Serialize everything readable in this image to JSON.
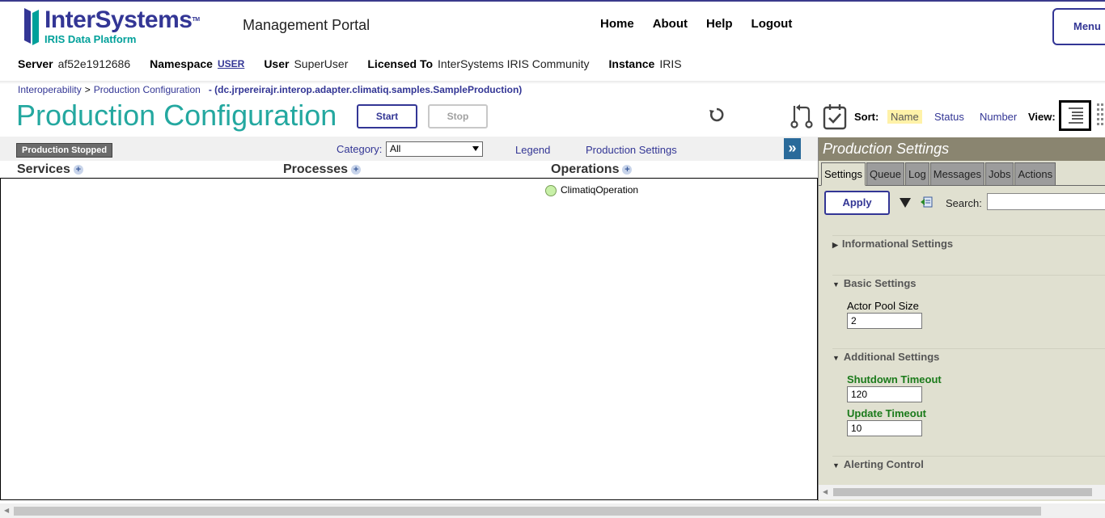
{
  "header": {
    "logo_name": "InterSystems",
    "logo_sub": "IRIS Data Platform",
    "portal_title": "Management Portal",
    "nav": [
      "Home",
      "About",
      "Help",
      "Logout"
    ],
    "menu_label": "Menu"
  },
  "info": {
    "server_label": "Server",
    "server": "af52e1912686",
    "namespace_label": "Namespace",
    "namespace": "USER",
    "user_label": "User",
    "user": "SuperUser",
    "licensed_label": "Licensed To",
    "licensed": "InterSystems IRIS Community",
    "instance_label": "Instance",
    "instance": "IRIS"
  },
  "breadcrumb": {
    "root": "Interoperability",
    "sep": ">",
    "current": "Production Configuration",
    "production": "- (dc.jrpereirajr.interop.adapter.climatiq.samples.SampleProduction)"
  },
  "page": {
    "title": "Production Configuration",
    "start_label": "Start",
    "stop_label": "Stop"
  },
  "sort": {
    "label": "Sort:",
    "options": [
      "Name",
      "Status",
      "Number"
    ],
    "selected": "Name",
    "view_label": "View:"
  },
  "diagram": {
    "status": "Production Stopped",
    "category_label": "Category:",
    "category_value": "All",
    "legend_link": "Legend",
    "settings_link": "Production Settings",
    "expand": "»",
    "columns": [
      "Services",
      "Processes",
      "Operations"
    ],
    "operations": [
      "ClimatiqOperation"
    ]
  },
  "panel": {
    "title": "Production Settings",
    "tabs": [
      "Settings",
      "Queue",
      "Log",
      "Messages",
      "Jobs",
      "Actions"
    ],
    "active_tab": "Settings",
    "apply_label": "Apply",
    "search_label": "Search:",
    "sections": {
      "informational": "Informational Settings",
      "basic": "Basic Settings",
      "additional": "Additional Settings",
      "alerting": "Alerting Control"
    },
    "fields": {
      "actor_pool_label": "Actor Pool Size",
      "actor_pool_value": "2",
      "shutdown_label": "Shutdown Timeout",
      "shutdown_value": "120",
      "update_label": "Update Timeout",
      "update_value": "10"
    }
  },
  "colors": {
    "brand": "#333695",
    "teal": "#24a8a0",
    "panel_bg": "#e0e0d0",
    "panel_title": "#8a8570",
    "status_green": "#c8f0a8"
  }
}
